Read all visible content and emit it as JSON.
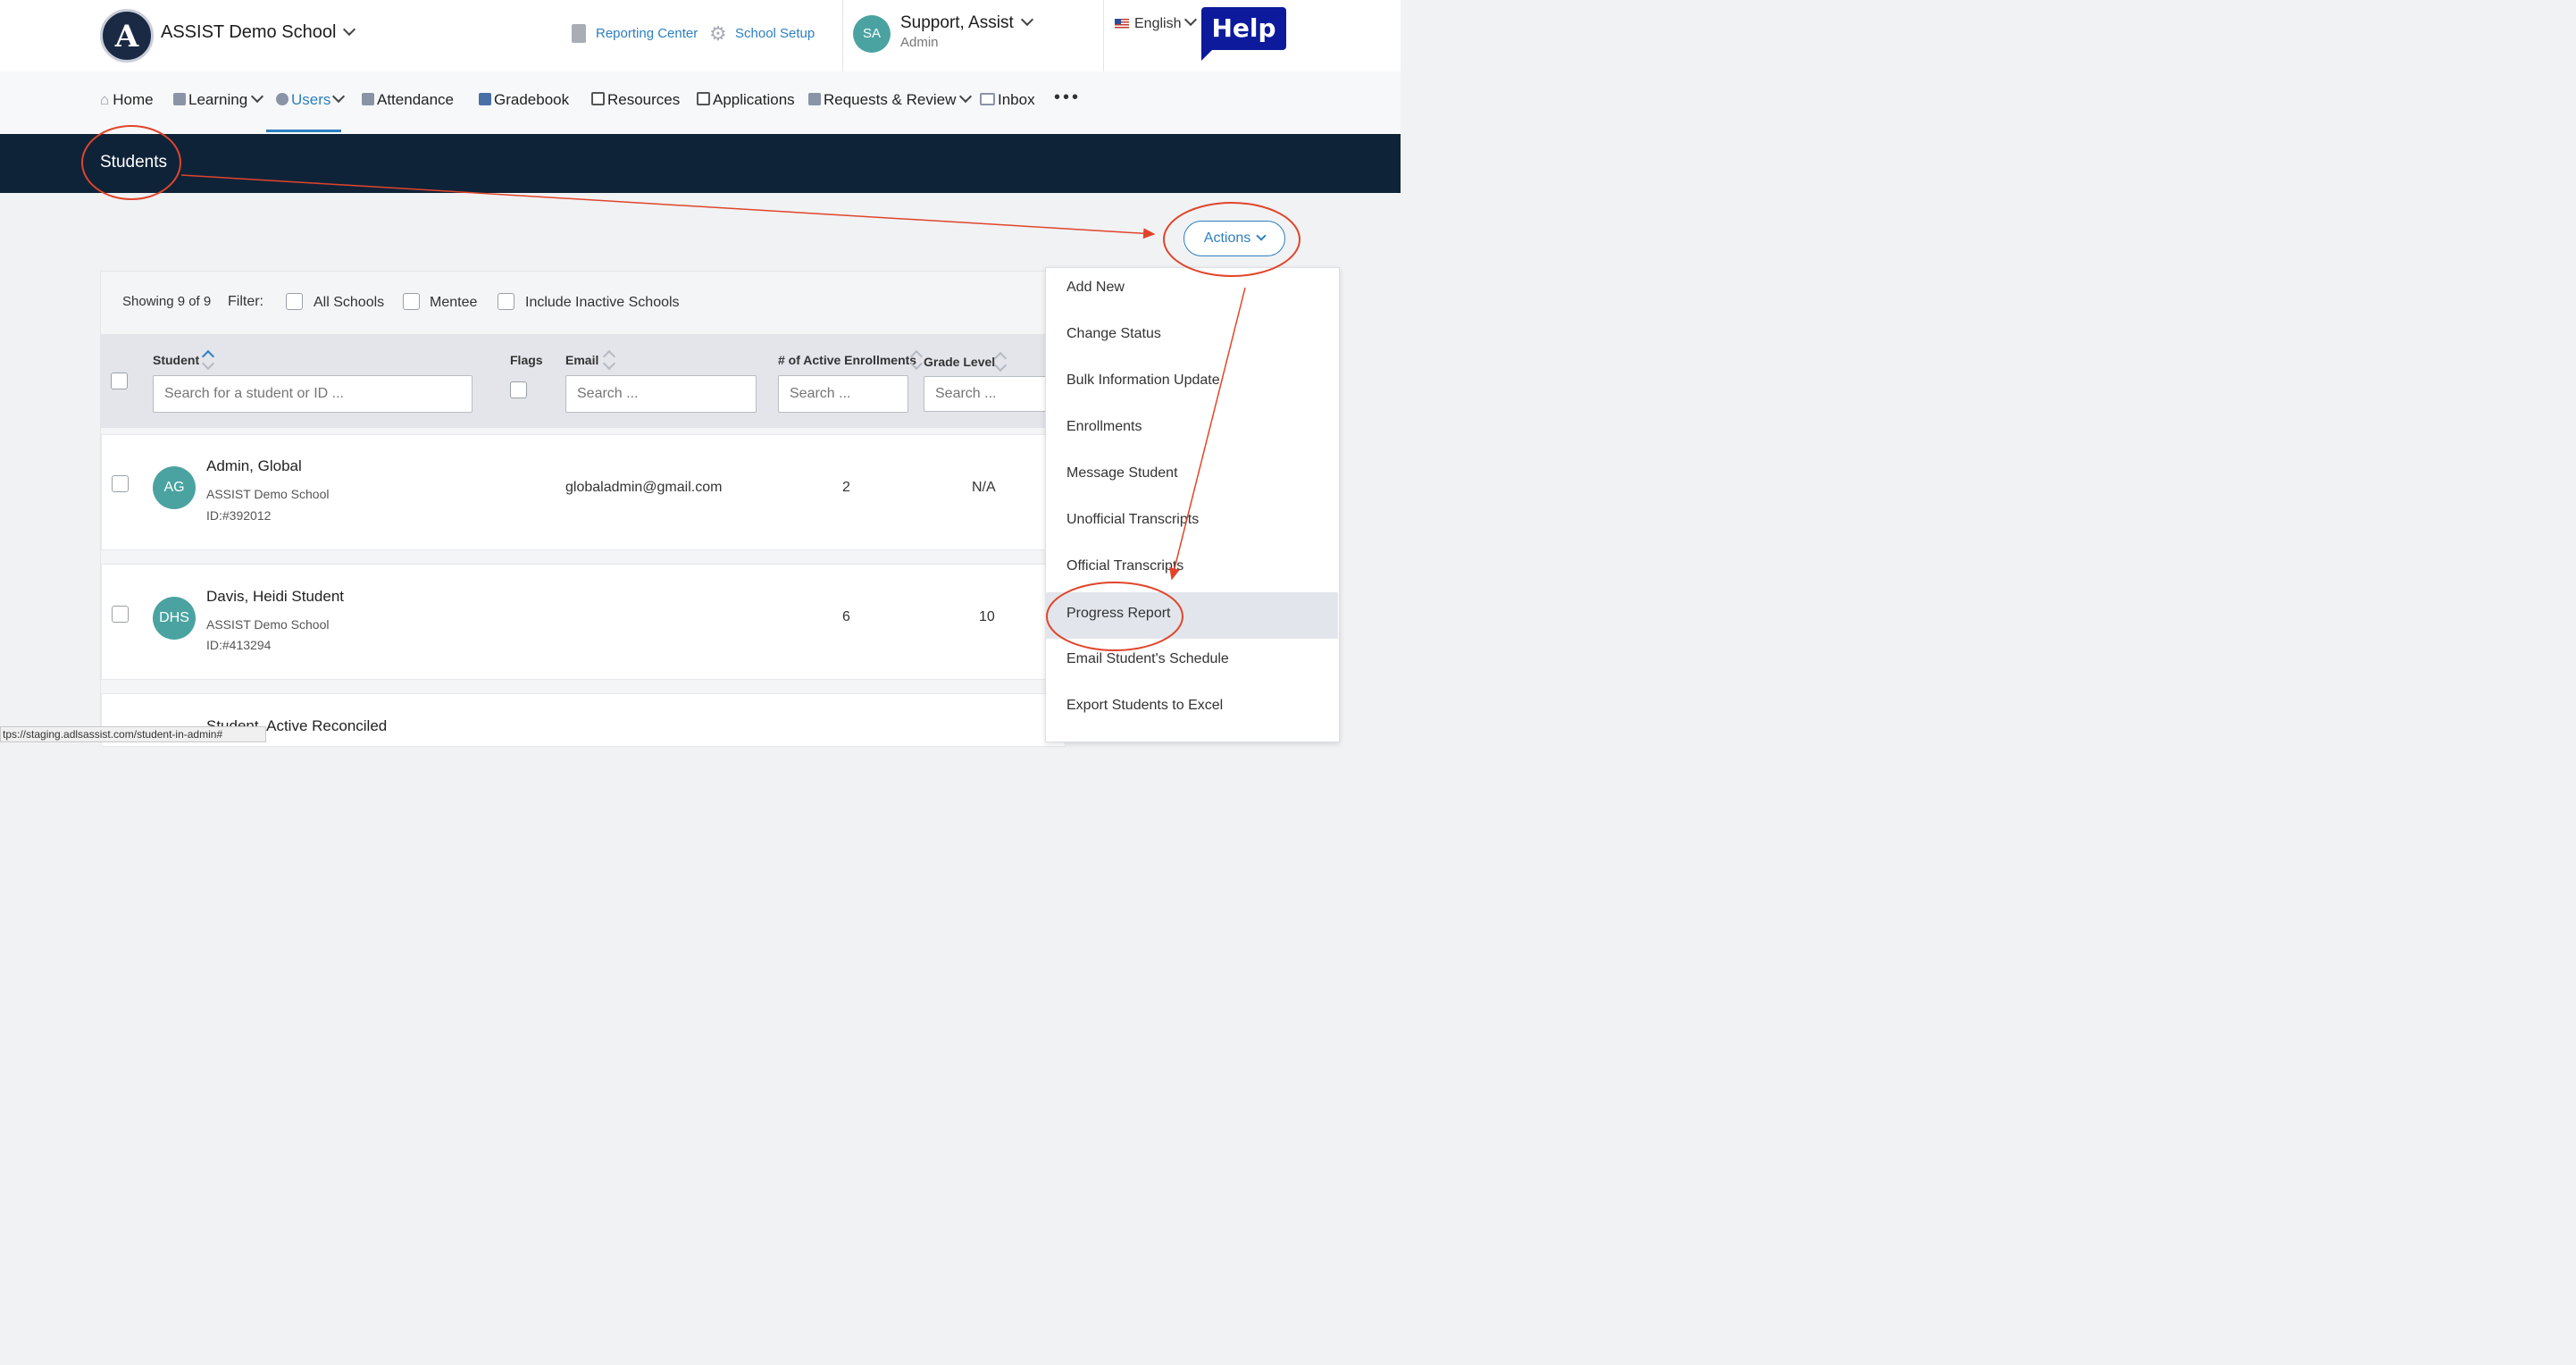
{
  "header": {
    "school_name": "ASSIST Demo School",
    "logo_letter": "A",
    "reporting_center": "Reporting Center",
    "school_setup": "School Setup",
    "user_initials": "SA",
    "user_name": "Support, Assist",
    "user_role": "Admin",
    "language": "English",
    "help_label": "Help"
  },
  "nav": {
    "items": [
      {
        "label": "Home",
        "icon": "home-icon"
      },
      {
        "label": "Learning",
        "icon": "learning-icon"
      },
      {
        "label": "Users",
        "icon": "user-icon",
        "active": true
      },
      {
        "label": "Attendance",
        "icon": "attendance-icon"
      },
      {
        "label": "Gradebook",
        "icon": "gradebook-icon"
      },
      {
        "label": "Resources",
        "icon": "resources-icon"
      },
      {
        "label": "Applications",
        "icon": "applications-icon"
      },
      {
        "label": "Requests & Review",
        "icon": "requests-icon"
      },
      {
        "label": "Inbox",
        "icon": "inbox-icon"
      }
    ],
    "more": "•••"
  },
  "page": {
    "title": "Students",
    "actions_label": "Actions"
  },
  "filter": {
    "showing": "Showing 9 of 9",
    "label": "Filter:",
    "all_schools": "All Schools",
    "mentee": "Mentee",
    "include_inactive": "Include Inactive Schools"
  },
  "table": {
    "headers": {
      "student": "Student",
      "flags": "Flags",
      "email": "Email",
      "enrollments": "# of Active Enrollments",
      "grade": "Grade Level"
    },
    "placeholders": {
      "student": "Search for a student or ID ...",
      "email": "Search ...",
      "enrollments": "Search ...",
      "grade": "Search ..."
    },
    "rows": [
      {
        "initials": "AG",
        "name": "Admin, Global",
        "school": "ASSIST Demo School",
        "id": "ID:#392012",
        "email": "globaladmin@gmail.com",
        "enrollments": "2",
        "grade": "N/A"
      },
      {
        "initials": "DHS",
        "name": "Davis, Heidi Student",
        "school": "ASSIST Demo School",
        "id": "ID:#413294",
        "email": "",
        "enrollments": "6",
        "grade": "10"
      },
      {
        "initials": "",
        "name": "Student, Active Reconciled",
        "school": "",
        "id": "",
        "email": "",
        "enrollments": "",
        "grade": ""
      }
    ]
  },
  "actions_menu": [
    "Add New",
    "Change Status",
    "Bulk Information Update",
    "Enrollments",
    "Message Student",
    "Unofficial Transcripts",
    "Official Transcripts",
    "Progress Report",
    "Email Student's Schedule",
    "Export Students to Excel"
  ],
  "highlighted_action": "Progress Report",
  "status_url": "tps://staging.adlsassist.com/student-in-admin#",
  "colors": {
    "accent": "#2d7fc0",
    "banner": "#0f2338",
    "avatar": "#4aa3a1",
    "annotation": "#e0452b",
    "help": "#0d1a9c"
  }
}
